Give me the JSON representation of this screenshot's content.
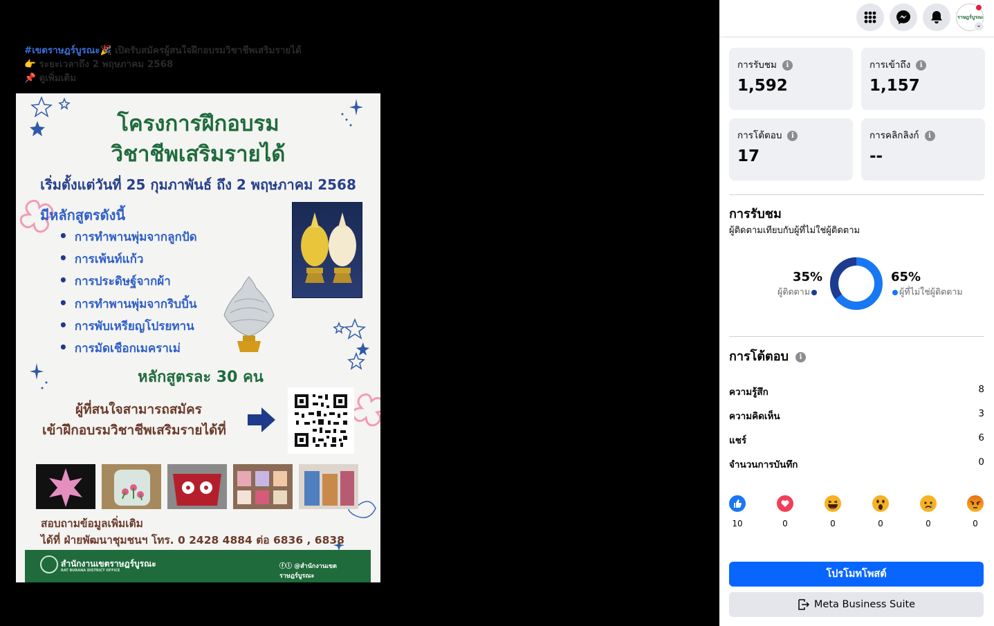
{
  "post": {
    "caption_hashtag": "#เขตราษฎร์บูรณะ",
    "caption_line1_rest": "🎉 เปิดรับสมัครผู้สนใจฝึกอบรมวิชาชีพเสริมรายได้",
    "caption_line2": "👉 ระยะเวลาถึง 2 พฤษภาคม 2568",
    "caption_line3": "📌 ดูเพิ่มเติม"
  },
  "poster": {
    "title1": "โครงการฝึกอบรม",
    "title2": "วิชาชีพเสริมรายได้",
    "date": "เริ่มตั้งแต่วันที่ 25 กุมภาพันธ์ ถึง 2 พฤษภาคม 2568",
    "courses_heading": "มีหลักสูตรดังนี้",
    "courses": [
      "การทำพานพุ่มจากลูกปัด",
      "การเพ้นท์แก้ว",
      "การประดิษฐ์จากผ้า",
      "การทำพานพุ่มจากริบบิ้น",
      "การพับเหรียญโปรยทาน",
      "การมัดเชือกเมคราเม่"
    ],
    "per_course": "หลักสูตรละ 30 คน",
    "apply1": "ผู้ที่สนใจสามารถสมัคร",
    "apply2": "เข้าฝึกอบรมวิชาชีพเสริมรายได้ที่",
    "contact1": "สอบถามข้อมูลเพิ่มเติม",
    "contact2": "ได้ที่ ฝ่ายพัฒนาชุมชนฯ โทร. 0 2428 4884 ต่อ 6836 , 6838",
    "footer_name": "สำนักงานเขตราษฎร์บูรณะ",
    "footer_sub": "RAT BURANA DISTRICT OFFICE",
    "footer_social": "@สำนักงานเขตราษฎร์บูรณะ"
  },
  "topbar": {
    "avatar_text": "ราษฎร์บูรณะ"
  },
  "stats": [
    {
      "label": "การรับชม",
      "value": "1,592"
    },
    {
      "label": "การเข้าถึง",
      "value": "1,157"
    },
    {
      "label": "การโต้ตอบ",
      "value": "17"
    },
    {
      "label": "การคลิกลิงก์",
      "value": "--"
    }
  ],
  "views_section": {
    "title": "การรับชม",
    "subtitle": "ผู้ติดตามเทียบกับผู้ที่ไม่ใช่ผู้ติดตาม",
    "followers_pct": "35%",
    "followers_label": "ผู้ติดตาม",
    "non_followers_pct": "65%",
    "non_followers_label": "ผู้ที่ไม่ใช่ผู้ติดตาม",
    "followers_value": 35,
    "non_followers_value": 65,
    "colors": {
      "followers": "#1d3c8f",
      "non_followers": "#1877f2"
    }
  },
  "engagement": {
    "title": "การโต้ตอบ",
    "rows": [
      {
        "label": "ความรู้สึก",
        "value": "8"
      },
      {
        "label": "ความคิดเห็น",
        "value": "3"
      },
      {
        "label": "แชร์",
        "value": "6"
      },
      {
        "label": "จำนวนการบันทึก",
        "value": "0"
      }
    ],
    "reactions": [
      {
        "icon": "like-icon",
        "count": "10"
      },
      {
        "icon": "love-icon",
        "count": "0"
      },
      {
        "icon": "haha-icon",
        "count": "0"
      },
      {
        "icon": "wow-icon",
        "count": "0"
      },
      {
        "icon": "sad-icon",
        "count": "0"
      },
      {
        "icon": "angry-icon",
        "count": "0"
      }
    ]
  },
  "buttons": {
    "promote": "โปรโมทโพสต์",
    "business_suite": "Meta Business Suite"
  }
}
